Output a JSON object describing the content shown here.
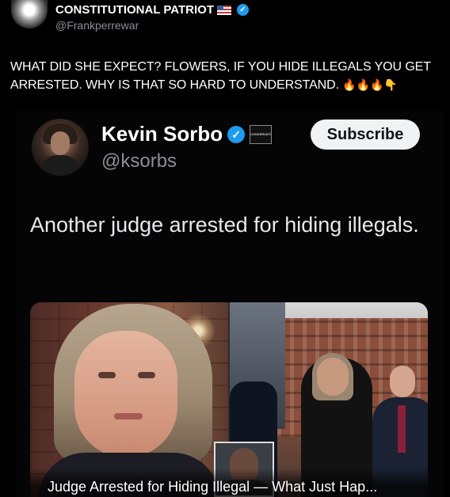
{
  "outer_post": {
    "author_name": "CONSTITUTIONAL PATRIOT",
    "flag_emoji": "🇺🇸",
    "handle": "@Frankperrewar",
    "text": "WHAT DID SHE EXPECT? FLOWERS, IF YOU HIDE ILLEGALS YOU GET ARRESTED. WHY IS THAT SO HARD TO UNDERSTAND.",
    "emojis": "🔥🔥🔥👇"
  },
  "quoted_post": {
    "author_name": "Kevin Sorbo",
    "handle": "@ksorbs",
    "affiliate_badge": "CONSERVATIVE",
    "subscribe_label": "Subscribe",
    "text": "Another judge arrested for hiding illegals.",
    "media_caption": "Judge Arrested for Hiding Illegal — What Just Hap..."
  },
  "colors": {
    "background": "#000000",
    "verified": "#1d9bf0",
    "subscribe_bg": "#eff3f4",
    "handle": "#8b8f94"
  },
  "icons": [
    "verified-badge-icon",
    "us-flag-icon",
    "fire-emoji",
    "pointing-down-emoji"
  ]
}
